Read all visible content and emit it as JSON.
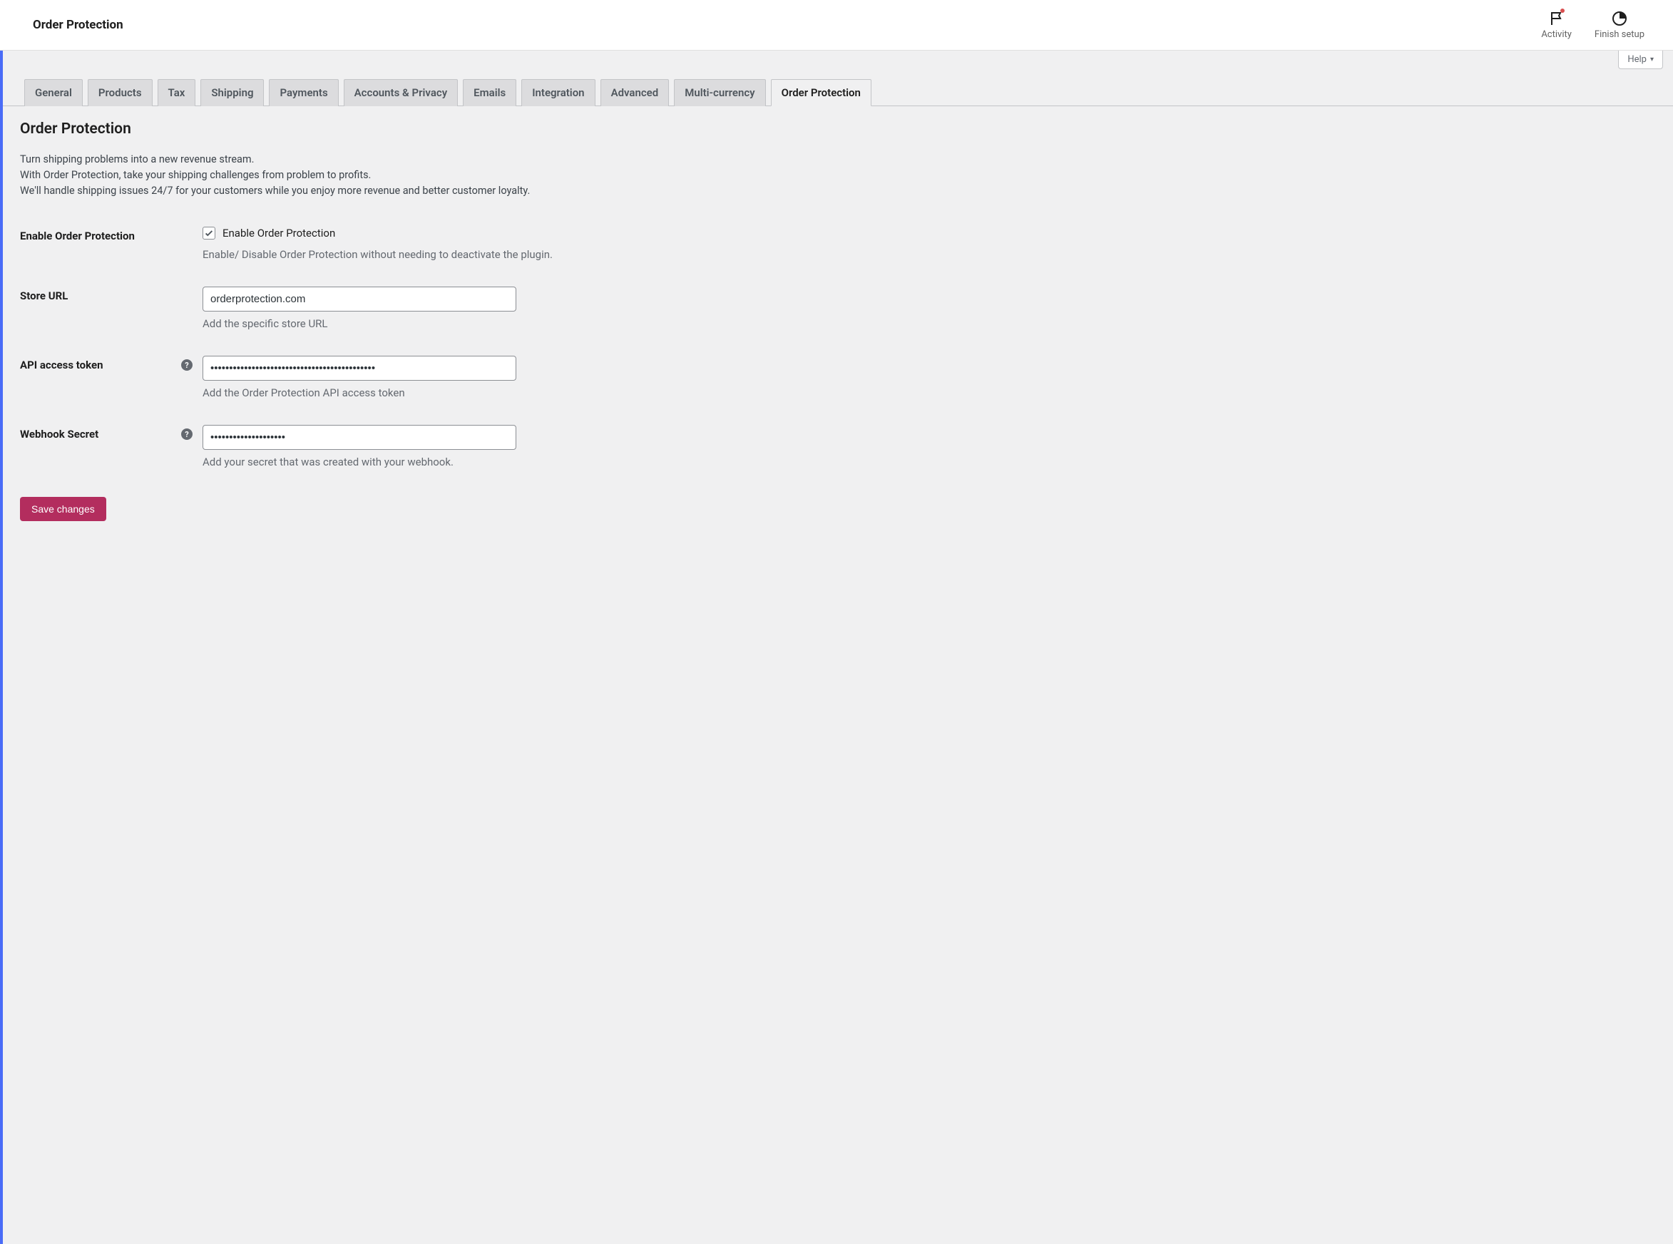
{
  "header": {
    "title": "Order Protection",
    "actions": {
      "activity": "Activity",
      "finish_setup": "Finish setup"
    }
  },
  "help_tab": "Help",
  "tabs": [
    {
      "label": "General",
      "active": false
    },
    {
      "label": "Products",
      "active": false
    },
    {
      "label": "Tax",
      "active": false
    },
    {
      "label": "Shipping",
      "active": false
    },
    {
      "label": "Payments",
      "active": false
    },
    {
      "label": "Accounts & Privacy",
      "active": false
    },
    {
      "label": "Emails",
      "active": false
    },
    {
      "label": "Integration",
      "active": false
    },
    {
      "label": "Advanced",
      "active": false
    },
    {
      "label": "Multi-currency",
      "active": false
    },
    {
      "label": "Order Protection",
      "active": true
    }
  ],
  "section": {
    "title": "Order Protection",
    "desc_line1": "Turn shipping problems into a new revenue stream.",
    "desc_line2": "With Order Protection, take your shipping challenges from problem to profits.",
    "desc_line3": "We'll handle shipping issues 24/7 for your customers while you enjoy more revenue and better customer loyalty."
  },
  "form": {
    "enable": {
      "label": "Enable Order Protection",
      "checkbox_label": "Enable Order Protection",
      "checked": true,
      "desc": "Enable/ Disable Order Protection without needing to deactivate the plugin."
    },
    "store_url": {
      "label": "Store URL",
      "value": "orderprotection.com",
      "desc": "Add the specific store URL"
    },
    "api_token": {
      "label": "API access token",
      "value": "••••••••••••••••••••••••••••••••••••••••••••",
      "desc": "Add the Order Protection API access token"
    },
    "webhook_secret": {
      "label": "Webhook Secret",
      "value": "••••••••••••••••••••",
      "desc": "Add your secret that was created with your webhook."
    },
    "save_button": "Save changes"
  }
}
